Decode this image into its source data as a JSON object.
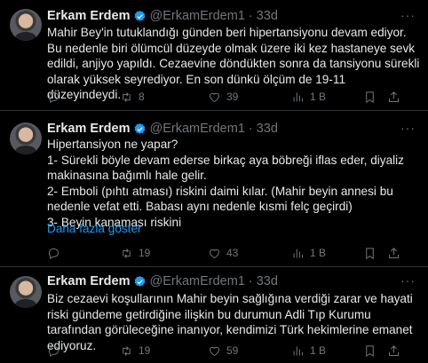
{
  "tweets": [
    {
      "name": "Erkam Erdem",
      "handle": "@ErkamErdem1",
      "time": "33d",
      "more": "···",
      "text": "Mahir Bey'in tutuklandığı günden beri hipertansiyonu devam ediyor. Bu nedenle biri ölümcül düzeyde olmak üzere iki kez hastaneye sevk edildi, anjiyo yapıldı. Cezaevine döndükten sonra da tansiyonu sürekli olarak yüksek seyrediyor. En son dünkü ölçüm de 19-11 düzeyindeydi.",
      "replies": "",
      "retweets": "8",
      "likes": "39",
      "views": "1 B"
    },
    {
      "name": "Erkam Erdem",
      "handle": "@ErkamErdem1",
      "time": "33d",
      "more": "···",
      "text": "Hipertansiyon ne yapar?\n1- Sürekli böyle devam ederse birkaç aya böbreği iflas eder, diyaliz makinasına bağımlı hale gelir.\n2- Emboli (pıhtı atması) riskini daimi kılar. (Mahir beyin annesi bu nedenle vefat etti. Babası aynı nedenle kısmi felç geçirdi)\n3- Beyin kanaması riskini",
      "show_more": "Daha fazla göster",
      "replies": "",
      "retweets": "19",
      "likes": "43",
      "views": "1 B"
    },
    {
      "name": "Erkam Erdem",
      "handle": "@ErkamErdem1",
      "time": "33d",
      "more": "···",
      "text": "Biz cezaevi koşullarının Mahir beyin sağlığına verdiği zarar ve hayati riski gündeme getirdiğine ilişkin bu durumun Adli Tıp Kurumu tarafından görüleceğine inanıyor, kendimizi Türk hekimlerine emanet ediyoruz.",
      "replies": "",
      "retweets": "19",
      "likes": "59",
      "views": "1 B"
    }
  ],
  "colors": {
    "accent": "#1d9bf0",
    "muted": "#71767b",
    "text": "#e7e9ea",
    "background": "#000000"
  },
  "icons": [
    "verified-badge-icon",
    "reply-icon",
    "retweet-icon",
    "like-icon",
    "views-icon",
    "bookmark-icon",
    "share-icon"
  ]
}
